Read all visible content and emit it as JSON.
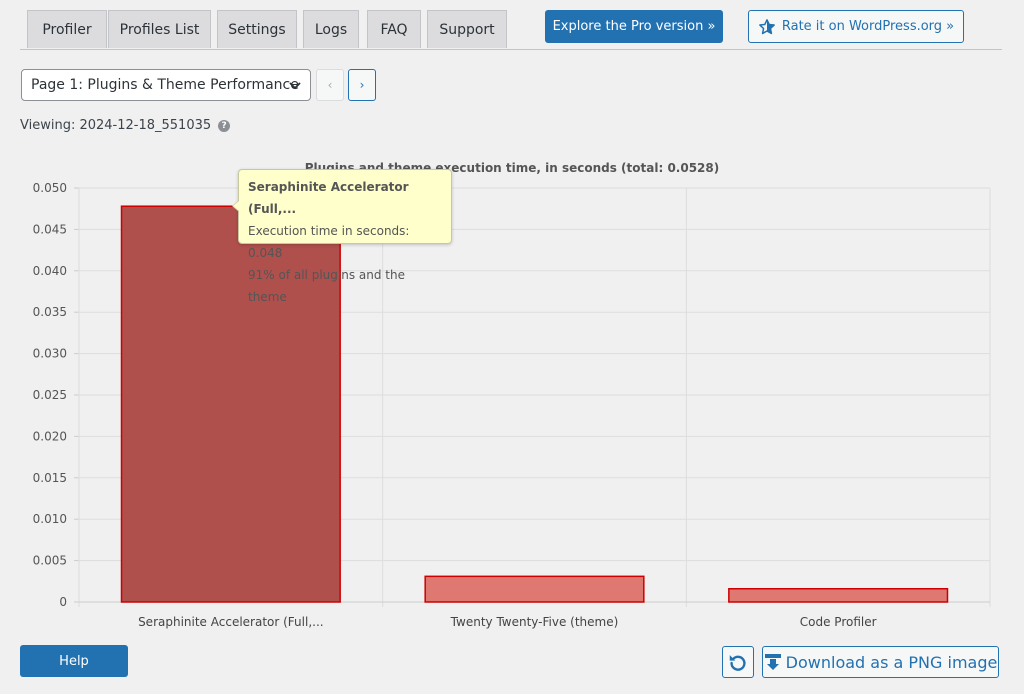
{
  "tabs": [
    "Profiler",
    "Profiles List",
    "Settings",
    "Logs",
    "FAQ",
    "Support"
  ],
  "pro_button": "Explore the Pro version »",
  "rate_button": "Rate it on WordPress.org »",
  "page_select": {
    "value": "Page 1: Plugins & Theme Performance"
  },
  "nav": {
    "prev": "‹",
    "next": "›"
  },
  "viewing": "Viewing: 2024-12-18_551035",
  "tooltip": {
    "title": "Seraphinite Accelerator (Full,...",
    "line1": "Execution time in seconds: 0.048",
    "line2": "91% of all plugins and the theme"
  },
  "help_button": "Help",
  "download_button": "Download as a PNG image",
  "colors": {
    "accent": "#2271b1",
    "bar_dark": "#b0504d",
    "bar_light": "#e07872",
    "bar_border": "#cc0000"
  },
  "chart_data": {
    "type": "bar",
    "title": "Plugins and theme execution time, in seconds (total: 0.0528)",
    "categories": [
      "Seraphinite Accelerator (Full,...",
      "Twenty Twenty-Five (theme)",
      "Code Profiler"
    ],
    "values": [
      0.0478,
      0.0031,
      0.0016
    ],
    "ylim": [
      0,
      0.05
    ],
    "yticks": [
      "0",
      "0.005",
      "0.010",
      "0.015",
      "0.020",
      "0.025",
      "0.030",
      "0.035",
      "0.040",
      "0.045",
      "0.050"
    ],
    "grid": true
  }
}
